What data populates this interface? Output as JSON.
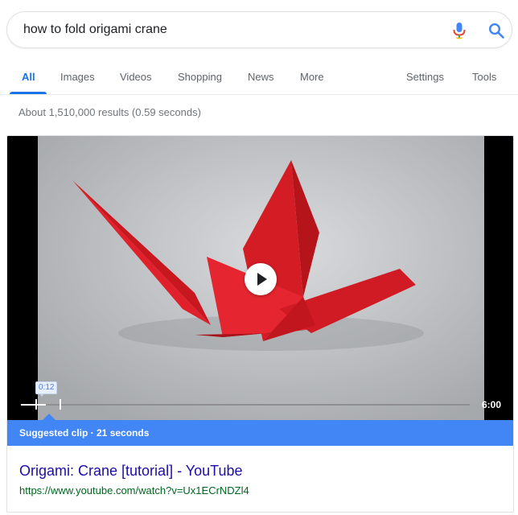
{
  "search": {
    "query": "how to fold origami crane",
    "mic_icon": "microphone-icon",
    "search_icon": "search-icon"
  },
  "tabs": [
    {
      "label": "All",
      "active": true
    },
    {
      "label": "Images"
    },
    {
      "label": "Videos"
    },
    {
      "label": "Shopping"
    },
    {
      "label": "News"
    },
    {
      "label": "More"
    },
    {
      "label": "Settings"
    },
    {
      "label": "Tools"
    }
  ],
  "result_stats": "About 1,510,000 results (0.59 seconds)",
  "video": {
    "clip_start": "0:12",
    "duration": "6:00",
    "suggested_clip": "Suggested clip · 21 seconds",
    "play_icon": "play-icon"
  },
  "result": {
    "title": "Origami: Crane [tutorial] - YouTube",
    "url": "https://www.youtube.com/watch?v=Ux1ECrNDZl4"
  },
  "colors": {
    "accent_blue": "#1a73e8",
    "suggested_bar": "#4285f4",
    "link": "#1a0dab",
    "url_green": "#006621",
    "crane_red": "#e0202a"
  }
}
